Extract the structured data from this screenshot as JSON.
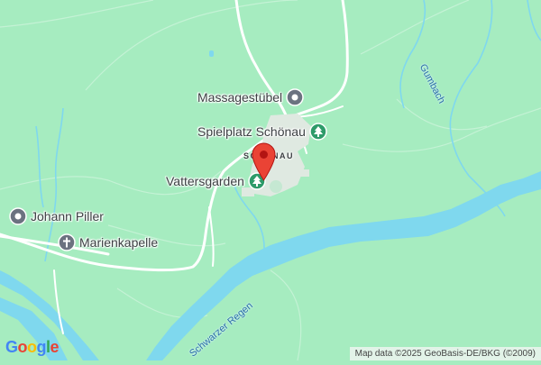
{
  "colors": {
    "land": "#a6ecc0",
    "water": "#7fd8ee",
    "road": "#ffffff",
    "settlement": "#dfe9e1",
    "park_icon": "#2e9b6a",
    "poi_icon": "#6b7280",
    "marker": "#ea4335"
  },
  "map": {
    "pois": [
      {
        "label": "Massagestübel",
        "icon": "circle-poi-icon"
      },
      {
        "label": "Spielplatz Schönau",
        "icon": "tree-icon"
      },
      {
        "label": "Vattersgarden",
        "icon": "tree-icon"
      },
      {
        "label": "Johann Piller",
        "icon": "circle-poi-icon"
      },
      {
        "label": "Marienkapelle",
        "icon": "cross-icon"
      }
    ],
    "place_label": "SCHÖNAU",
    "rivers": [
      {
        "label": "Gumbach"
      },
      {
        "label": "Schwarzer Regen"
      }
    ],
    "marker": {
      "icon": "location-pin-icon"
    }
  },
  "footer": {
    "logo_letters": [
      "G",
      "o",
      "o",
      "g",
      "l",
      "e"
    ],
    "logo_colors": [
      "#4285F4",
      "#EA4335",
      "#FBBC05",
      "#4285F4",
      "#34A853",
      "#EA4335"
    ],
    "attribution": "Map data ©2025 GeoBasis-DE/BKG (©2009)"
  }
}
